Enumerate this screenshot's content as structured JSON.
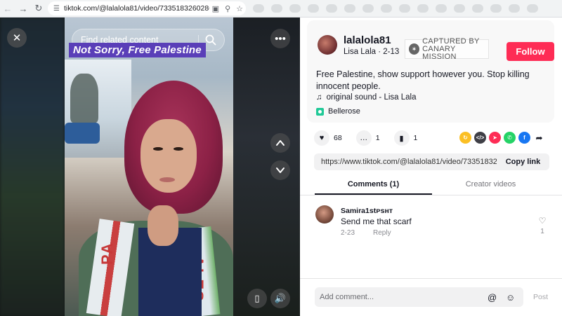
{
  "browser": {
    "url": "tiktok.com/@lalalola81/video/7335183260286..."
  },
  "video": {
    "search_placeholder": "Find related content",
    "caption": "Not Sorry, Free Palestine",
    "scarf_text_left": "PA",
    "scarf_text_right": "ALES"
  },
  "author": {
    "username": "lalalola81",
    "display_name": "Lisa Lala",
    "date": "2-13",
    "badge_line1": "CAPTURED BY",
    "badge_line2": "CANARY MISSION",
    "follow_label": "Follow"
  },
  "post": {
    "description": "Free Palestine, show support however you. Stop killing innocent people.",
    "sound": "original sound - Lisa Lala",
    "location": "Bellerose"
  },
  "stats": {
    "likes": "68",
    "comments": "1",
    "saves": "1"
  },
  "share": {
    "link": "https://www.tiktok.com/@lalalola81/video/7335183260...",
    "copy_label": "Copy link",
    "colors": [
      "#fbbf24",
      "#3f3f46",
      "#fe2c55",
      "#25d366",
      "#1877f2"
    ]
  },
  "tabs": {
    "comments": "Comments (1)",
    "creator_videos": "Creator videos"
  },
  "comments": [
    {
      "name": "Samira1stᴘsʜᴛ",
      "text": "Send me that scarf",
      "date": "2-23",
      "reply": "Reply",
      "likes": "1"
    }
  ],
  "composer": {
    "placeholder": "Add comment...",
    "post_label": "Post"
  }
}
